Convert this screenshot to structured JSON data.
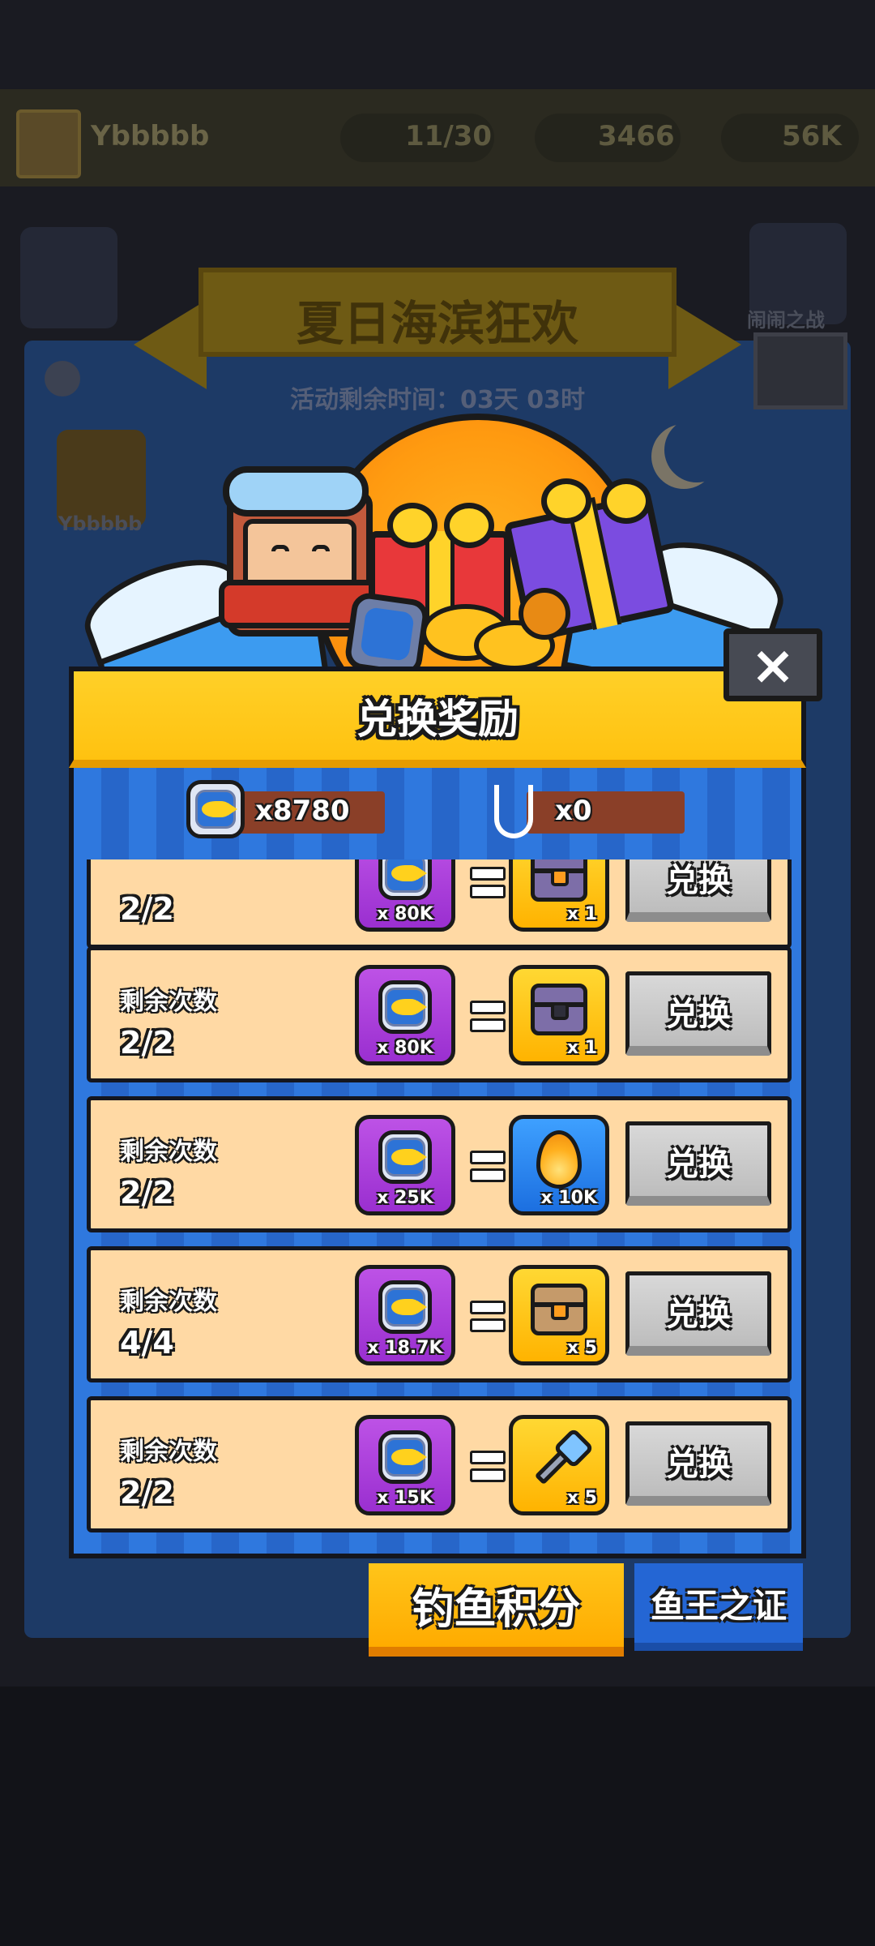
{
  "background": {
    "player_name": "Ybbbbb",
    "stat_1": "11/30",
    "stat_2": "3466",
    "stat_3": "56K",
    "event_title": "夏日海滨狂欢",
    "event_timer": "活动剩余时间：03天 03时",
    "side_right_label": "闹闹之战",
    "side_left_label": "Ybbbbb"
  },
  "modal": {
    "title": "兑换奖励",
    "close_label": "×",
    "currencies": [
      {
        "icon": "fish-badge-icon",
        "value": "x8780"
      },
      {
        "icon": "fishing-hook-icon",
        "value": "x0"
      }
    ],
    "rows": [
      {
        "label": "",
        "count": "2/2",
        "cost": "x 80K",
        "reward_icon": "hex-chest-icon",
        "reward_qty": "x 1",
        "button": "兑换"
      },
      {
        "label": "剩余次数",
        "count": "2/2",
        "cost": "x 80K",
        "reward_icon": "dark-chest-icon",
        "reward_qty": "x 1",
        "button": "兑换"
      },
      {
        "label": "剩余次数",
        "count": "2/2",
        "cost": "x 25K",
        "reward_icon": "flame-icon",
        "reward_qty": "x 10K",
        "button": "兑换"
      },
      {
        "label": "剩余次数",
        "count": "4/4",
        "cost": "x 18.7K",
        "reward_icon": "chest-icon",
        "reward_qty": "x 5",
        "button": "兑换"
      },
      {
        "label": "剩余次数",
        "count": "2/2",
        "cost": "x 15K",
        "reward_icon": "key-icon",
        "reward_qty": "x 5",
        "button": "兑换"
      }
    ]
  },
  "tabs": {
    "active": "钓鱼积分",
    "inactive": "鱼王之证"
  },
  "colors": {
    "modal_blue": "#2c6fd6",
    "header_gold": "#ffc210",
    "row_bg": "#ffd9a4",
    "cost_purple": "#9a2fd0",
    "button_gray": "#c8c8c8"
  }
}
